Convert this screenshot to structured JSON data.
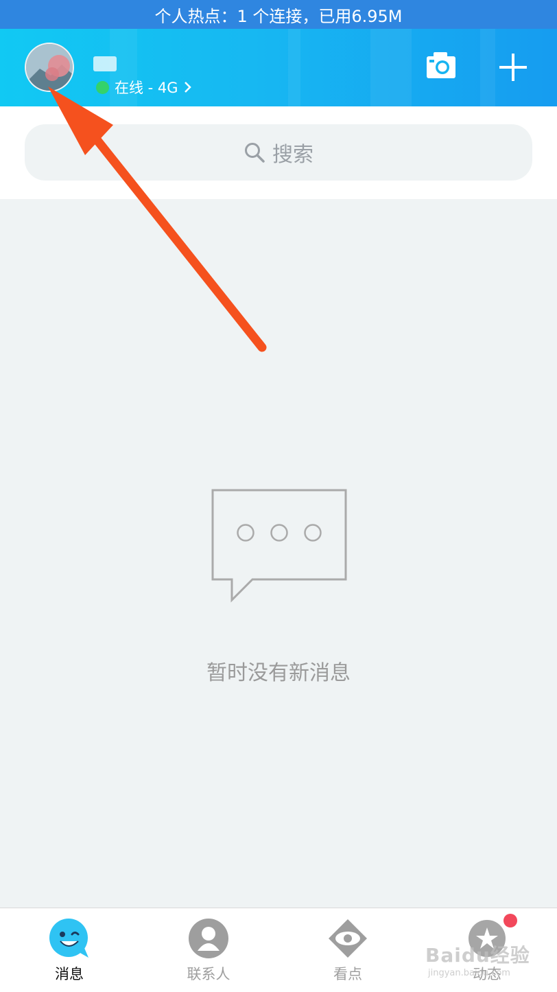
{
  "status_bar": {
    "hotspot_text": "个人热点：1 个连接，已用6.95M"
  },
  "header": {
    "avatar_icon": "user-avatar-photo",
    "nickname": "",
    "status_text": "在线 - 4G",
    "status_color": "#34d26a",
    "camera_icon": "camera-icon",
    "plus_icon": "plus-icon"
  },
  "search": {
    "placeholder": "搜索",
    "icon": "search-icon"
  },
  "empty_state": {
    "icon": "chat-bubble-icon",
    "text": "暂时没有新消息"
  },
  "tabs": [
    {
      "label": "消息",
      "icon": "message-smiley-icon",
      "active": true
    },
    {
      "label": "联系人",
      "icon": "contacts-icon",
      "active": false
    },
    {
      "label": "看点",
      "icon": "eye-icon",
      "active": false
    },
    {
      "label": "动态",
      "icon": "star-planet-icon",
      "active": false,
      "badge": true
    }
  ],
  "colors": {
    "header_gradient_start": "#11c9f3",
    "header_gradient_end": "#169cf0",
    "hotspot_bar": "#2f86e0",
    "annotation_arrow": "#f5511e",
    "badge": "#f2485b"
  },
  "watermark": {
    "main": "Baidu经验",
    "sub": "jingyan.baidu.com"
  }
}
